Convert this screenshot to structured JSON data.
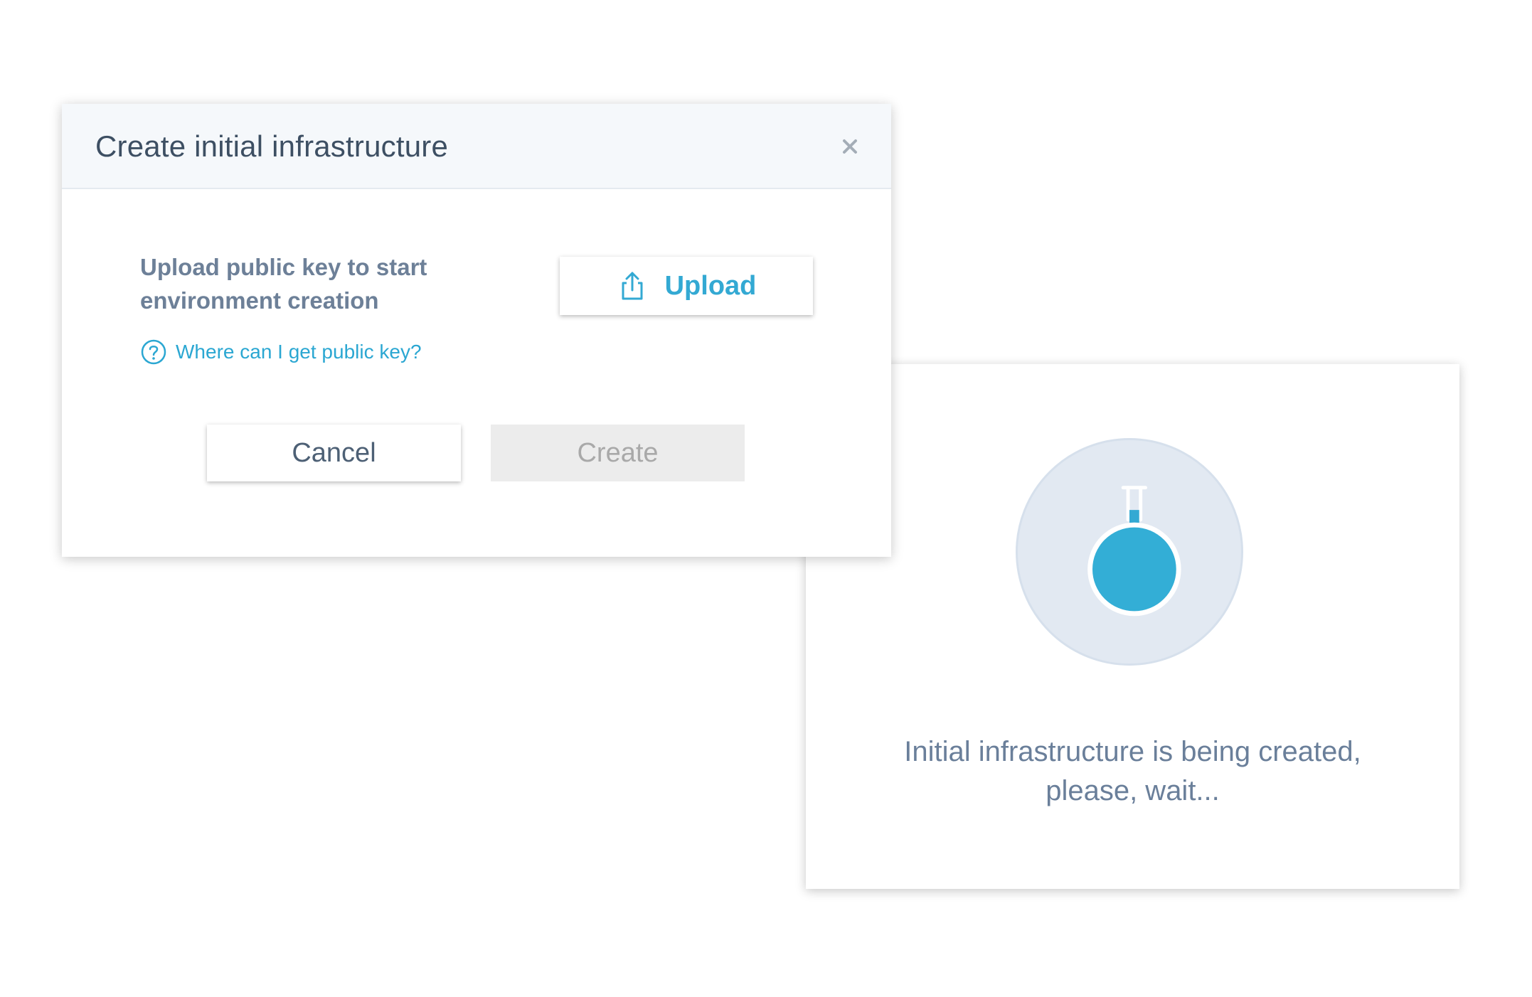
{
  "dialog": {
    "title": "Create initial infrastructure",
    "instruction_line1": "Upload public key to start",
    "instruction_line2": "environment creation",
    "upload_label": "Upload",
    "help_link": "Where can I get public key?",
    "cancel_label": "Cancel",
    "create_label": "Create",
    "create_disabled": true
  },
  "progress": {
    "message_line1": "Initial infrastructure is being created,",
    "message_line2": "please, wait...",
    "icon": "flask-icon"
  },
  "colors": {
    "accent": "#33a9d3",
    "title_text": "#3d4f63",
    "secondary_text": "#6d8098",
    "header_bg": "#f5f8fb",
    "disabled_bg": "#ececec",
    "disabled_text": "#a9a9a9",
    "flask_circle_bg": "#e2e9f2"
  }
}
